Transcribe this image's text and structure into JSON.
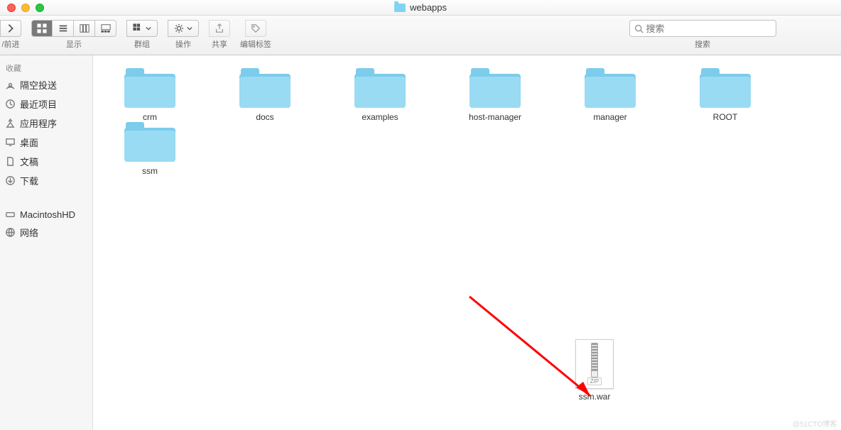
{
  "window": {
    "title": "webapps"
  },
  "toolbar": {
    "nav_label": "/前进",
    "view_label": "显示",
    "group_label": "群组",
    "action_label": "操作",
    "share_label": "共享",
    "tags_label": "编辑标签",
    "search_label": "搜索",
    "search_placeholder": "搜索"
  },
  "sidebar": {
    "favorites_header": "收藏",
    "items": [
      {
        "label": "隔空投送",
        "icon": "airdrop"
      },
      {
        "label": "最近项目",
        "icon": "clock"
      },
      {
        "label": "应用程序",
        "icon": "apps"
      },
      {
        "label": "桌面",
        "icon": "desktop"
      },
      {
        "label": "文稿",
        "icon": "doc"
      },
      {
        "label": "下载",
        "icon": "download"
      }
    ],
    "devices": [
      {
        "label": "MacintoshHD",
        "icon": "disk"
      },
      {
        "label": "网络",
        "icon": "globe"
      }
    ]
  },
  "content": {
    "folders": [
      {
        "name": "crm"
      },
      {
        "name": "docs"
      },
      {
        "name": "examples"
      },
      {
        "name": "host-manager"
      },
      {
        "name": "manager"
      },
      {
        "name": "ROOT"
      },
      {
        "name": "ssm"
      }
    ],
    "file": {
      "name": "ssm.war",
      "badge": "ZIP"
    }
  },
  "watermark": "@51CTO博客"
}
